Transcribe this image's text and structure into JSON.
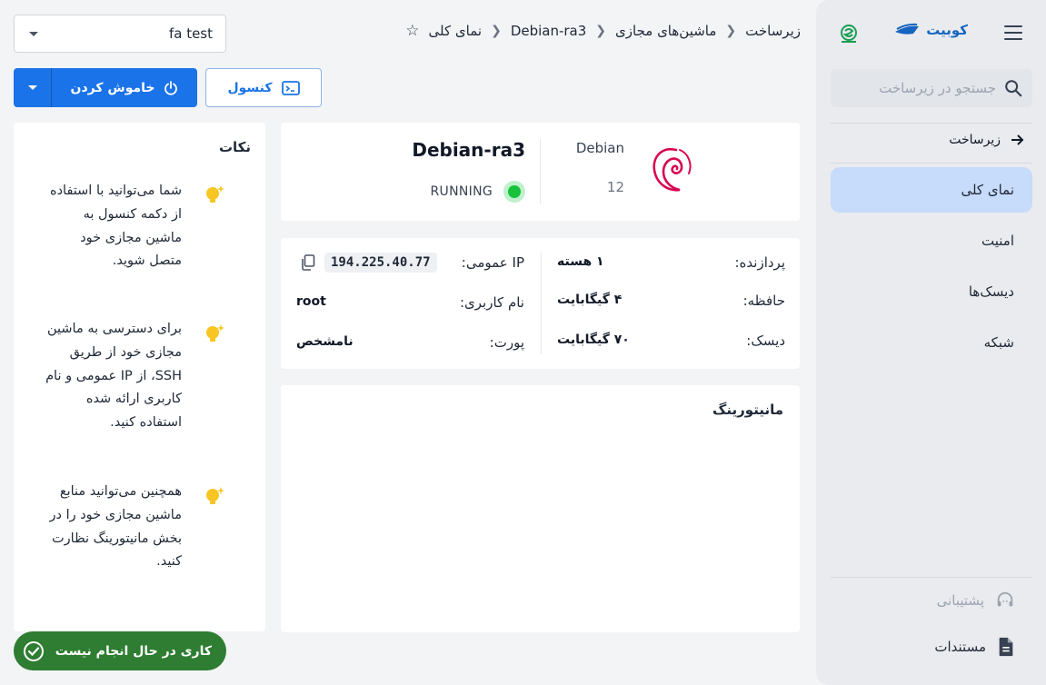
{
  "sidebar": {
    "brand_name": "کوبیت",
    "search_placeholder": "جستجو در زیرساخت",
    "back_label": "زیرساخت",
    "items": [
      {
        "label": "نمای کلی",
        "active": true
      },
      {
        "label": "امنیت",
        "active": false
      },
      {
        "label": "دیسک‌ها",
        "active": false
      },
      {
        "label": "شبکه",
        "active": false
      }
    ],
    "support_label": "پشتیبانی",
    "docs_label": "مستندات"
  },
  "breadcrumb": {
    "items": [
      "زیرساخت",
      "ماشین‌های مجازی",
      "Debian-ra3",
      "نمای کلی"
    ]
  },
  "project_select": {
    "value": "fa test"
  },
  "actions": {
    "shutdown_label": "خاموش کردن",
    "console_label": "کنسول"
  },
  "vm": {
    "name": "Debian-ra3",
    "status": "RUNNING",
    "os_name": "Debian",
    "os_version": "12"
  },
  "specs": {
    "cpu_label": "پردازنده:",
    "cpu_value": "۱ هسته",
    "ram_label": "حافظه:",
    "ram_value": "۴ گیگابایت",
    "disk_label": "دیسک:",
    "disk_value": "۷۰ گیگابایت",
    "ip_label": "IP عمومی:",
    "ip_value": "194.225.40.77",
    "user_label": "نام کاربری:",
    "user_value": "root",
    "port_label": "پورت:",
    "port_value": "نامشخص"
  },
  "monitoring": {
    "title": "مانیتورینگ"
  },
  "tips": {
    "title": "نکات",
    "items": [
      "شما می‌توانید با استفاده از دکمه کنسول به ماشین مجازی خود متصل شوید.",
      "برای دسترسی به ماشین مجازی خود از طریق SSH، از IP عمومی و نام کاربری ارائه شده استفاده کنید.",
      "همچنین می‌توانید منابع ماشین مجازی خود را در بخش مانیتورینگ نظارت کنید."
    ]
  },
  "toast": {
    "label": "کاری در حال انجام نیست"
  },
  "colors": {
    "primary": "#1a73e8",
    "success": "#2e7d32",
    "active_nav": "#c7dbfa",
    "running": "#16c23a"
  }
}
